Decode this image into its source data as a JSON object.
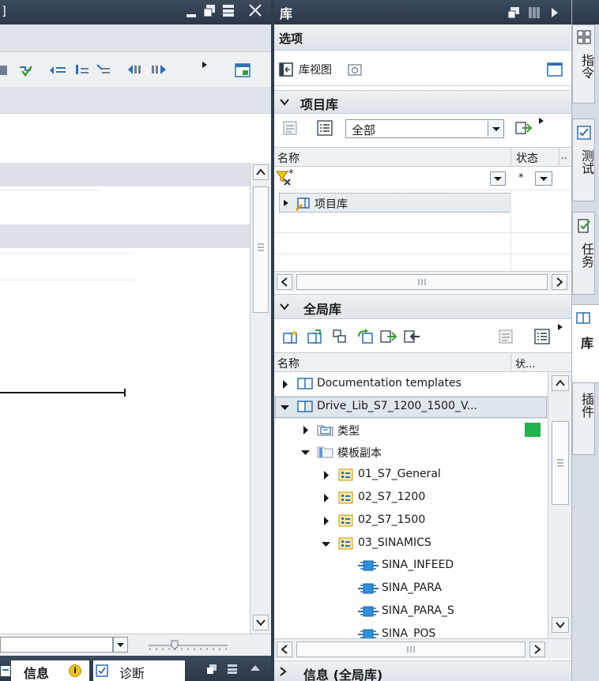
{
  "left_window": {
    "title_fragment": "]",
    "info_tab": "信息",
    "diag_tab": "诊断"
  },
  "library": {
    "title": "库",
    "options_label": "选项",
    "library_view_label": "库视图",
    "project_library": {
      "section_title": "项目库",
      "filter_value": "全部",
      "col_name": "名称",
      "col_status": "状态",
      "filter_name": "*",
      "filter_status": "*",
      "root_item": "项目库"
    },
    "global_library": {
      "section_title": "全局库",
      "col_name": "名称",
      "col_status": "状...",
      "items": [
        {
          "label": "Documentation templates",
          "level": 0,
          "expanded": false,
          "icon": "library-icon"
        },
        {
          "label": "Drive_Lib_S7_1200_1500_V...",
          "level": 0,
          "expanded": true,
          "icon": "library-icon",
          "selected": true
        },
        {
          "label": "类型",
          "level": 1,
          "expanded": false,
          "icon": "types-folder-icon",
          "status_color": "#22b14c"
        },
        {
          "label": "模板副本",
          "level": 1,
          "expanded": true,
          "icon": "folder-icon"
        },
        {
          "label": "01_S7_General",
          "level": 2,
          "expanded": false,
          "icon": "copy-folder-icon"
        },
        {
          "label": "02_S7_1200",
          "level": 2,
          "expanded": false,
          "icon": "copy-folder-icon"
        },
        {
          "label": "02_S7_1500",
          "level": 2,
          "expanded": false,
          "icon": "copy-folder-icon"
        },
        {
          "label": "03_SINAMICS",
          "level": 2,
          "expanded": true,
          "icon": "copy-folder-icon"
        },
        {
          "label": "SINA_INFEED",
          "level": 3,
          "icon": "block-icon"
        },
        {
          "label": "SINA_PARA",
          "level": 3,
          "icon": "block-icon"
        },
        {
          "label": "SINA_PARA_S",
          "level": 3,
          "icon": "block-icon"
        },
        {
          "label": "SINA_POS",
          "level": 3,
          "icon": "block-icon"
        }
      ]
    },
    "info_section": "信息 (全局库)"
  },
  "side_tabs": [
    "指令",
    "测试",
    "任务",
    "库",
    "插件"
  ],
  "colors": {
    "header_dark": "#2f3d4c",
    "section_bg": "#dde3ea",
    "selection": "#dfe6ee",
    "status_green": "#22b14c"
  }
}
